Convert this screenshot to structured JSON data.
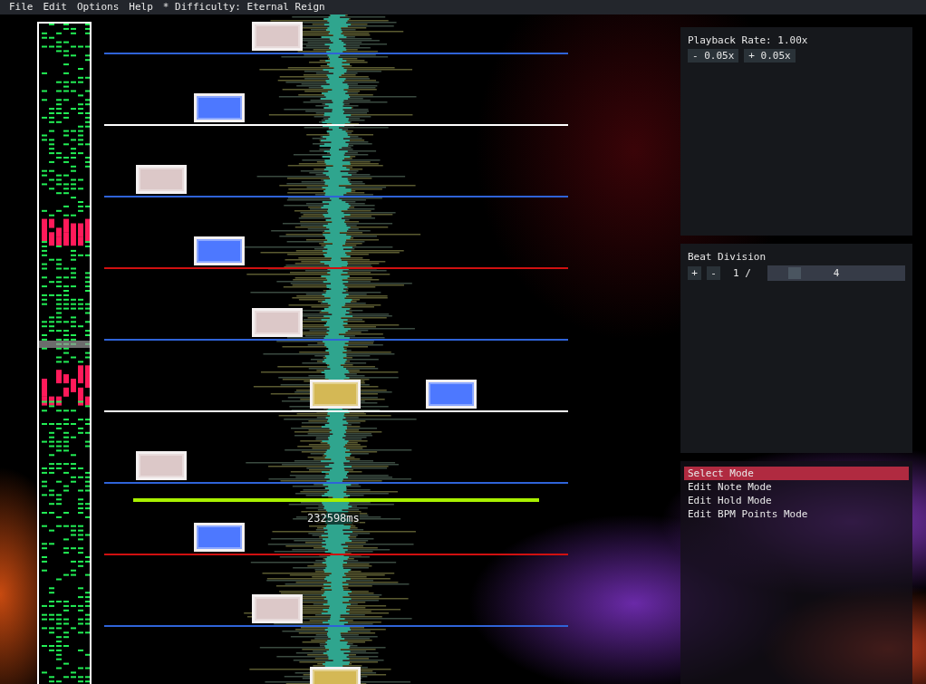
{
  "menu": {
    "items": [
      "File",
      "Edit",
      "Options",
      "Help"
    ],
    "title": "* Difficulty: Eternal Reign"
  },
  "editor": {
    "rows": [
      {
        "color": "#2f63d8",
        "lanes": [
          {
            "kind": "empty"
          },
          {
            "kind": "empty"
          },
          {
            "kind": "note",
            "color": "#dcc8c8"
          },
          {
            "kind": "empty"
          },
          {
            "kind": "empty"
          },
          {
            "kind": "empty"
          },
          {
            "kind": "empty"
          }
        ]
      },
      {
        "color": "#ffffff",
        "lanes": [
          {
            "kind": "empty"
          },
          {
            "kind": "note",
            "color": "#4d78ff"
          },
          {
            "kind": "empty"
          },
          {
            "kind": "empty"
          },
          {
            "kind": "empty"
          },
          {
            "kind": "empty"
          },
          {
            "kind": "empty"
          }
        ]
      },
      {
        "color": "#2f63d8",
        "lanes": [
          {
            "kind": "note",
            "color": "#dcc8c8"
          },
          {
            "kind": "empty"
          },
          {
            "kind": "empty"
          },
          {
            "kind": "empty"
          },
          {
            "kind": "empty"
          },
          {
            "kind": "empty"
          },
          {
            "kind": "empty"
          }
        ]
      },
      {
        "color": "#d01010",
        "lanes": [
          {
            "kind": "empty"
          },
          {
            "kind": "note",
            "color": "#4d78ff"
          },
          {
            "kind": "empty"
          },
          {
            "kind": "empty"
          },
          {
            "kind": "empty"
          },
          {
            "kind": "empty"
          },
          {
            "kind": "empty"
          }
        ]
      },
      {
        "color": "#2f63d8",
        "lanes": [
          {
            "kind": "empty"
          },
          {
            "kind": "empty"
          },
          {
            "kind": "note",
            "color": "#dcc8c8"
          },
          {
            "kind": "empty"
          },
          {
            "kind": "empty"
          },
          {
            "kind": "empty"
          },
          {
            "kind": "empty"
          }
        ]
      },
      {
        "color": "#ffffff",
        "lanes": [
          {
            "kind": "empty"
          },
          {
            "kind": "empty"
          },
          {
            "kind": "empty"
          },
          {
            "kind": "note",
            "color": "#d4b855"
          },
          {
            "kind": "empty"
          },
          {
            "kind": "note",
            "color": "#4d78ff"
          },
          {
            "kind": "empty"
          }
        ]
      },
      {
        "color": "#2f63d8",
        "lanes": [
          {
            "kind": "note",
            "color": "#dcc8c8"
          },
          {
            "kind": "empty"
          },
          {
            "kind": "empty"
          },
          {
            "kind": "empty"
          },
          {
            "kind": "empty"
          },
          {
            "kind": "empty"
          },
          {
            "kind": "empty"
          }
        ]
      },
      {
        "color": "#d01010",
        "lanes": [
          {
            "kind": "empty"
          },
          {
            "kind": "note",
            "color": "#4d78ff"
          },
          {
            "kind": "empty"
          },
          {
            "kind": "empty"
          },
          {
            "kind": "empty"
          },
          {
            "kind": "empty"
          },
          {
            "kind": "empty"
          }
        ]
      },
      {
        "color": "#2f63d8",
        "lanes": [
          {
            "kind": "empty"
          },
          {
            "kind": "empty"
          },
          {
            "kind": "note",
            "color": "#dcc8c8"
          },
          {
            "kind": "empty"
          },
          {
            "kind": "empty"
          },
          {
            "kind": "empty"
          },
          {
            "kind": "empty"
          }
        ]
      },
      {
        "lanes": [
          {
            "kind": "empty"
          },
          {
            "kind": "empty"
          },
          {
            "kind": "empty"
          },
          {
            "kind": "note",
            "color": "#d4b855"
          },
          {
            "kind": "empty"
          },
          {
            "kind": "empty"
          },
          {
            "kind": "empty"
          }
        ]
      }
    ],
    "playhead_time": "232598ms"
  },
  "playback": {
    "label": "Playback Rate: 1.00x",
    "buttons": [
      "- 0.05x",
      "+ 0.05x"
    ]
  },
  "beat_division": {
    "title": "Beat Division",
    "buttons": [
      "+",
      "-"
    ],
    "prefix": "1 /",
    "value": "4",
    "level": 0.15
  },
  "modes": [
    {
      "label": "Select Mode",
      "selected": true
    },
    {
      "label": "Edit Note Mode",
      "selected": false
    },
    {
      "label": "Edit Hold Mode",
      "selected": false
    },
    {
      "label": "Edit BPM Points Mode",
      "selected": false
    }
  ]
}
